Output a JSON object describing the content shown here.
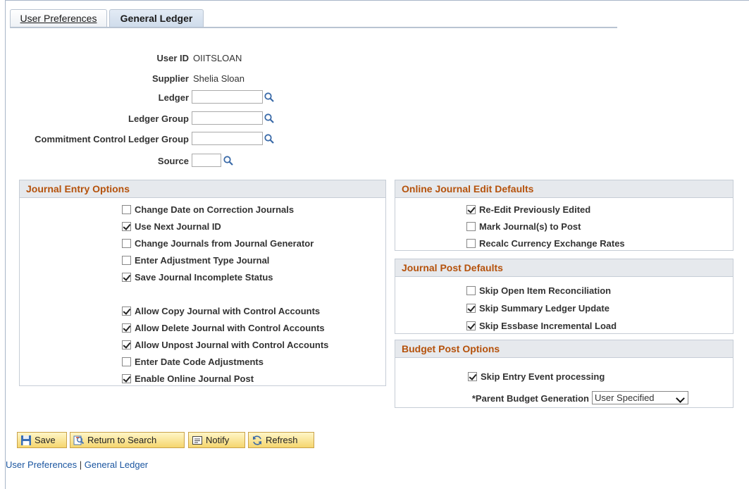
{
  "tabs": [
    {
      "label": "User Preferences"
    },
    {
      "label": "General Ledger"
    }
  ],
  "header": {
    "user_id_label": "User ID",
    "user_id_value": "OIITSLOAN",
    "supplier_label": "Supplier",
    "supplier_value": "Shelia Sloan",
    "ledger_label": "Ledger",
    "ledger_group_label": "Ledger Group",
    "cc_ledger_group_label": "Commitment Control Ledger Group",
    "source_label": "Source",
    "ledger_value": "",
    "ledger_group_value": "",
    "cc_ledger_group_value": "",
    "source_value": ""
  },
  "journal_entry_options": {
    "title": "Journal Entry Options",
    "items": [
      {
        "label": "Change Date on Correction Journals",
        "checked": false
      },
      {
        "label": "Use Next Journal ID",
        "checked": true
      },
      {
        "label": "Change Journals from Journal Generator",
        "checked": false
      },
      {
        "label": "Enter Adjustment Type Journal",
        "checked": false
      },
      {
        "label": "Save Journal Incomplete Status",
        "checked": true
      },
      {
        "label": "Allow Copy Journal with Control Accounts",
        "checked": true
      },
      {
        "label": "Allow Delete Journal with Control Accounts",
        "checked": true
      },
      {
        "label": "Allow Unpost Journal with Control Accounts",
        "checked": true
      },
      {
        "label": "Enter Date Code Adjustments",
        "checked": false
      },
      {
        "label": "Enable Online Journal Post",
        "checked": true
      }
    ]
  },
  "online_journal_edit_defaults": {
    "title": "Online Journal Edit Defaults",
    "items": [
      {
        "label": "Re-Edit Previously Edited",
        "checked": true
      },
      {
        "label": "Mark Journal(s) to Post",
        "checked": false
      },
      {
        "label": "Recalc Currency Exchange Rates",
        "checked": false
      }
    ]
  },
  "journal_post_defaults": {
    "title": "Journal Post Defaults",
    "items": [
      {
        "label": "Skip Open Item Reconciliation",
        "checked": false
      },
      {
        "label": "Skip Summary Ledger Update",
        "checked": true
      },
      {
        "label": "Skip Essbase Incremental Load",
        "checked": true
      }
    ]
  },
  "budget_post_options": {
    "title": "Budget Post Options",
    "skip_entry_label": "Skip Entry Event processing",
    "skip_entry_checked": true,
    "parent_budget_label": "*Parent Budget Generation",
    "parent_budget_value": "User Specified"
  },
  "toolbar": {
    "save_label": "Save",
    "return_label": "Return to Search",
    "notify_label": "Notify",
    "refresh_label": "Refresh"
  },
  "footer": {
    "link1": "User Preferences",
    "separator": "|",
    "link2": "General Ledger"
  },
  "colors": {
    "accent_orange": "#b5520c",
    "link_blue": "#1b56a0",
    "button_gold": "#f5d66e"
  }
}
